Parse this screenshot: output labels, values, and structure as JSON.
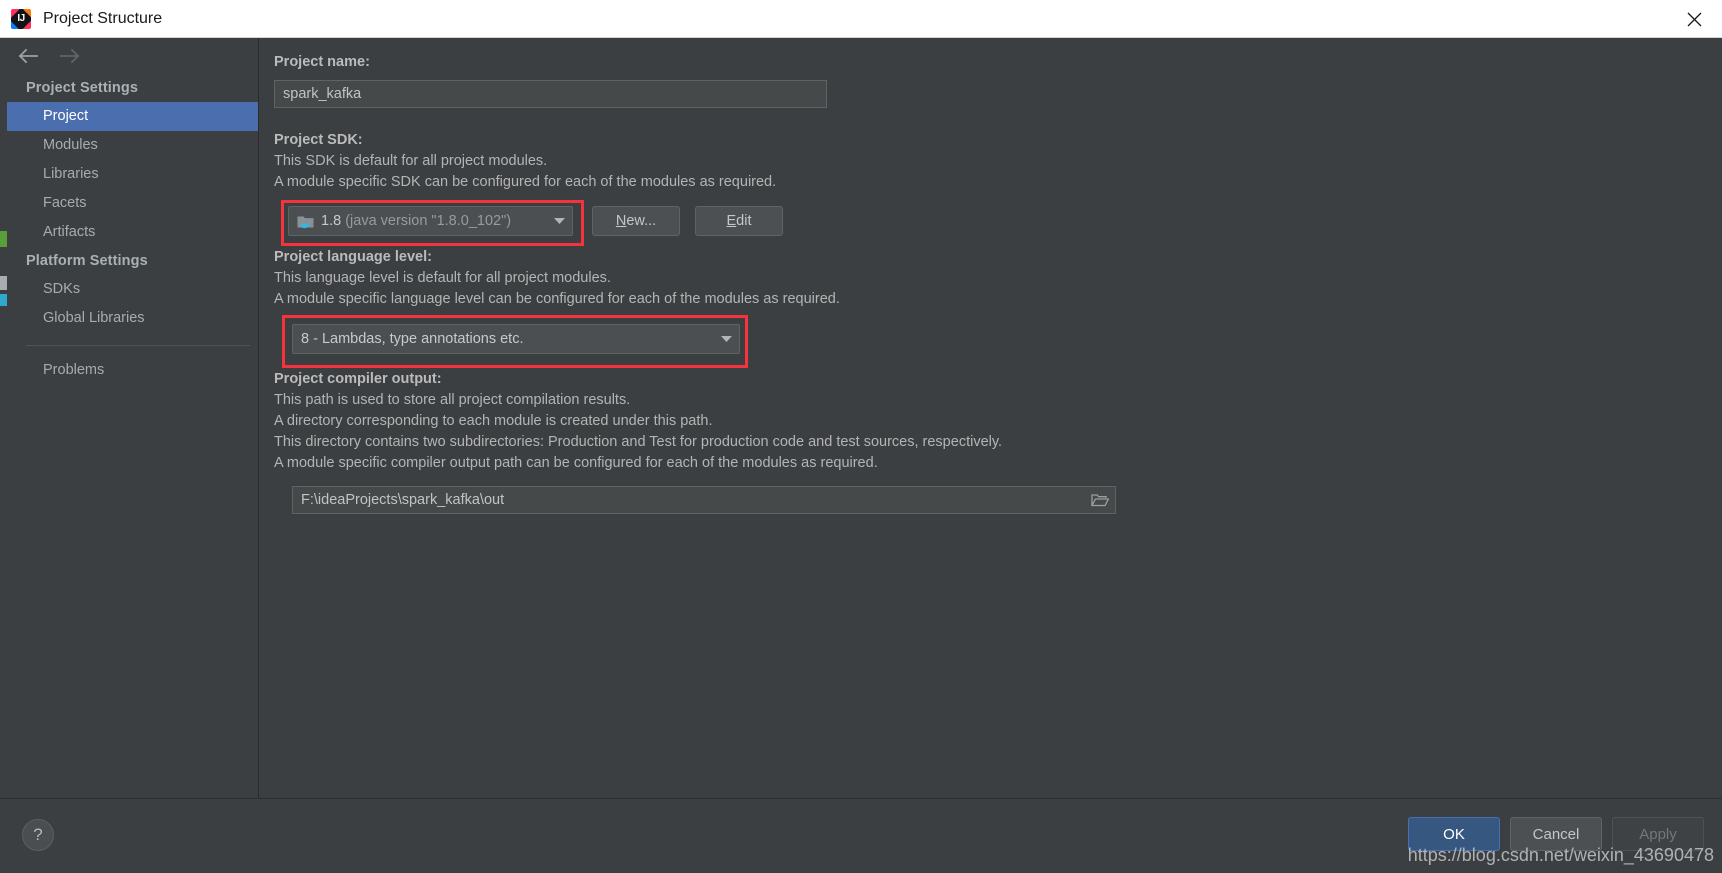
{
  "window": {
    "title": "Project Structure",
    "logo_text": "IJ",
    "logo_icon": "intellij-idea-logo",
    "close_icon": "close-icon"
  },
  "nav": {
    "back_icon": "arrow-left-icon",
    "forward_icon": "arrow-right-icon"
  },
  "sidebar": {
    "groups": [
      {
        "label": "Project Settings",
        "items": [
          {
            "label": "Project",
            "selected": true
          },
          {
            "label": "Modules",
            "selected": false
          },
          {
            "label": "Libraries",
            "selected": false
          },
          {
            "label": "Facets",
            "selected": false
          },
          {
            "label": "Artifacts",
            "selected": false
          }
        ]
      },
      {
        "label": "Platform Settings",
        "items": [
          {
            "label": "SDKs",
            "selected": false
          },
          {
            "label": "Global Libraries",
            "selected": false
          }
        ]
      }
    ],
    "extra_items": [
      {
        "label": "Problems",
        "selected": false
      }
    ]
  },
  "main": {
    "project_name": {
      "label": "Project name:",
      "value": "spark_kafka",
      "placeholder": ""
    },
    "project_sdk": {
      "label": "Project SDK:",
      "desc_line1": "This SDK is default for all project modules.",
      "desc_line2": "A module specific SDK can be configured for each of the modules as required.",
      "selected_name": "1.8",
      "selected_detail": "(java version \"1.8.0_102\")",
      "icon": "java-sdk-folder-icon",
      "dropdown_icon": "chevron-down-icon",
      "new_button": "New...",
      "new_button_mnemonic": "N",
      "edit_button": "Edit",
      "edit_button_mnemonic": "E",
      "highlighted": true
    },
    "language_level": {
      "label": "Project language level:",
      "desc_line1": "This language level is default for all project modules.",
      "desc_line2": "A module specific language level can be configured for each of the modules as required.",
      "value": "8 - Lambdas, type annotations etc.",
      "dropdown_icon": "chevron-down-icon",
      "highlighted": true
    },
    "compiler_output": {
      "label": "Project compiler output:",
      "desc_line1": "This path is used to store all project compilation results.",
      "desc_line2": "A directory corresponding to each module is created under this path.",
      "desc_line3": "This directory contains two subdirectories: Production and Test for production code and test sources, respectively.",
      "desc_line4": "A module specific compiler output path can be configured for each of the modules as required.",
      "value": "F:\\ideaProjects\\spark_kafka\\out",
      "browse_icon": "folder-browse-icon"
    }
  },
  "footer": {
    "help_label": "?",
    "help_icon": "help-icon",
    "ok_label": "OK",
    "cancel_label": "Cancel",
    "apply_label": "Apply",
    "apply_disabled": true
  },
  "overlay": {
    "watermark": "https://blog.csdn.net/weixin_43690478"
  },
  "colors": {
    "background": "#3c3f41",
    "selection": "#4b6eaf",
    "highlight_box": "#f5333f",
    "primary_button": "#365880",
    "titlebar": "#ffffff"
  }
}
